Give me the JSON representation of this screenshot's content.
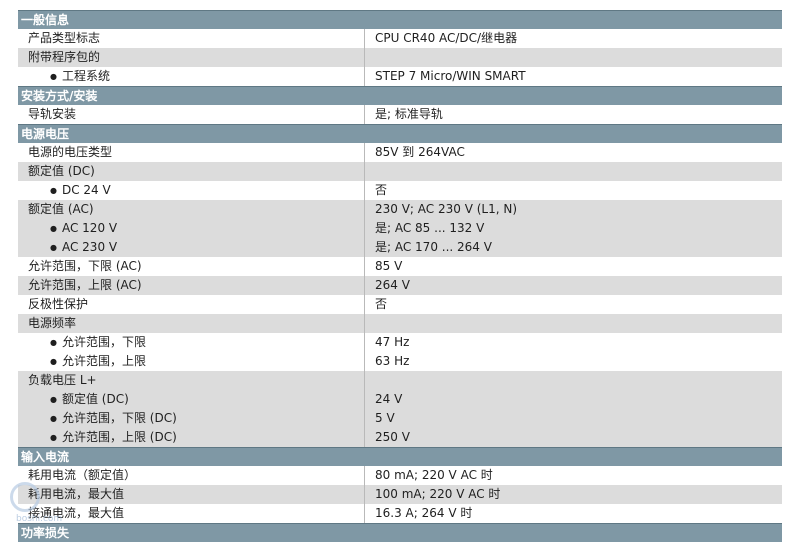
{
  "sections": [
    {
      "title": "一般信息",
      "rows": [
        {
          "label": "产品类型标志",
          "value": "CPU CR40 AC/DC/继电器",
          "bullet": false,
          "shade": "w"
        },
        {
          "label": "附带程序包的",
          "value": "",
          "bullet": false,
          "shade": "g"
        },
        {
          "label": "工程系统",
          "value": "STEP 7 Micro/WIN SMART",
          "bullet": true,
          "shade": "w"
        }
      ]
    },
    {
      "title": "安装方式/安装",
      "rows": [
        {
          "label": "导轨安装",
          "value": "是; 标准导轨",
          "bullet": false,
          "shade": "w"
        }
      ]
    },
    {
      "title": "电源电压",
      "rows": [
        {
          "label": "电源的电压类型",
          "value": "85V 到 264VAC",
          "bullet": false,
          "shade": "w"
        },
        {
          "label": "额定值 (DC)",
          "value": "",
          "bullet": false,
          "shade": "g"
        },
        {
          "label": "DC 24 V",
          "value": "否",
          "bullet": true,
          "shade": "w"
        },
        {
          "label": "额定值 (AC)",
          "value": "230 V; AC 230 V (L1, N)",
          "bullet": false,
          "shade": "g"
        },
        {
          "label": "AC 120 V",
          "value": "是; AC 85 ... 132 V",
          "bullet": true,
          "shade": "g"
        },
        {
          "label": "AC 230 V",
          "value": "是; AC 170 ... 264 V",
          "bullet": true,
          "shade": "g"
        },
        {
          "label": "允许范围，下限 (AC)",
          "value": "85 V",
          "bullet": false,
          "shade": "w"
        },
        {
          "label": "允许范围，上限 (AC)",
          "value": "264 V",
          "bullet": false,
          "shade": "g"
        },
        {
          "label": "反极性保护",
          "value": "否",
          "bullet": false,
          "shade": "w"
        },
        {
          "label": "电源频率",
          "value": "",
          "bullet": false,
          "shade": "g"
        },
        {
          "label": "允许范围，下限",
          "value": "47 Hz",
          "bullet": true,
          "shade": "w"
        },
        {
          "label": "允许范围，上限",
          "value": "63 Hz",
          "bullet": true,
          "shade": "w"
        },
        {
          "label": "负载电压 L+",
          "value": "",
          "bullet": false,
          "shade": "g"
        },
        {
          "label": "额定值 (DC)",
          "value": "24 V",
          "bullet": true,
          "shade": "g"
        },
        {
          "label": "允许范围，下限 (DC)",
          "value": "5 V",
          "bullet": true,
          "shade": "g"
        },
        {
          "label": "允许范围，上限 (DC)",
          "value": "250 V",
          "bullet": true,
          "shade": "g"
        }
      ]
    },
    {
      "title": "输入电流",
      "rows": [
        {
          "label": "耗用电流（额定值）",
          "value": "80 mA; 220 V AC 时",
          "bullet": false,
          "shade": "w"
        },
        {
          "label": "耗用电流，最大值",
          "value": "100 mA; 220 V AC 时",
          "bullet": false,
          "shade": "g"
        },
        {
          "label": "接通电流，最大值",
          "value": "16.3 A; 264 V 时",
          "bullet": false,
          "shade": "w"
        }
      ]
    },
    {
      "title": "功率损失",
      "rows": []
    }
  ],
  "watermark": {
    "text": "boshi.com"
  }
}
